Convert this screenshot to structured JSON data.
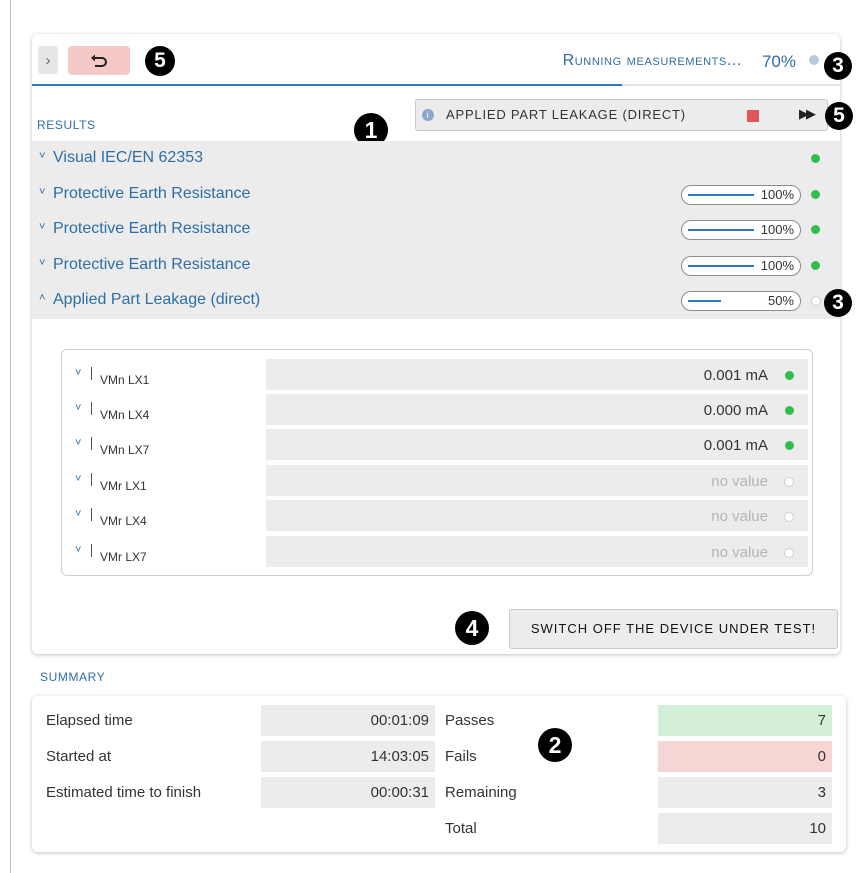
{
  "toolbar": {
    "collapse_glyph": "›",
    "back_icon": "undo-icon",
    "status_text": "Running measurements...",
    "progress_percent": "70%",
    "progress_fraction": 0.73
  },
  "callouts": {
    "one": "1",
    "two": "2",
    "three": "3",
    "four": "4",
    "five": "5"
  },
  "results": {
    "label": "RESULTS",
    "current_test": {
      "label": "APPLIED PART LEAKAGE (DIRECT)",
      "stop_icon": "stop-icon",
      "skip_glyph": "▶▶"
    },
    "tests": [
      {
        "name": "Visual IEC/EN 62353",
        "chevron": "˅",
        "progress": null,
        "progress_label": "",
        "status": "pass"
      },
      {
        "name": "Protective Earth Resistance",
        "chevron": "˅",
        "progress": 1.0,
        "progress_label": "100%",
        "status": "pass"
      },
      {
        "name": "Protective Earth Resistance",
        "chevron": "˅",
        "progress": 1.0,
        "progress_label": "100%",
        "status": "pass"
      },
      {
        "name": "Protective Earth Resistance",
        "chevron": "˅",
        "progress": 1.0,
        "progress_label": "100%",
        "status": "pass"
      },
      {
        "name": "Applied Part Leakage (direct)",
        "chevron": "˄",
        "progress": 0.5,
        "progress_label": "50%",
        "status": "pending"
      }
    ],
    "measurements": [
      {
        "name": "VMn LX1",
        "value": "0.001 mA",
        "status": "pass"
      },
      {
        "name": "VMn LX4",
        "value": "0.000 mA",
        "status": "pass"
      },
      {
        "name": "VMn LX7",
        "value": "0.001 mA",
        "status": "pass"
      },
      {
        "name": "VMr LX1",
        "value": "no value",
        "status": "pending"
      },
      {
        "name": "VMr LX4",
        "value": "no value",
        "status": "pending"
      },
      {
        "name": "VMr LX7",
        "value": "no value",
        "status": "pending"
      }
    ],
    "switch_button": "SWITCH OFF THE DEVICE UNDER TEST!"
  },
  "summary": {
    "label": "SUMMARY",
    "left": [
      {
        "label": "Elapsed time",
        "value": "00:01:09"
      },
      {
        "label": "Started at",
        "value": "14:03:05"
      },
      {
        "label": "Estimated time to finish",
        "value": "00:00:31"
      }
    ],
    "right": [
      {
        "label": "Passes",
        "value": "7",
        "kind": "pass"
      },
      {
        "label": "Fails",
        "value": "0",
        "kind": "fail"
      },
      {
        "label": "Remaining",
        "value": "3",
        "kind": "neutral"
      },
      {
        "label": "Total",
        "value": "10",
        "kind": "neutral"
      }
    ]
  },
  "colors": {
    "accent": "#2e6ea6",
    "progress_blue": "#2e79c0",
    "pass_green": "#2fbf4d",
    "pass_bg": "#d4efd7",
    "fail_bg": "#f6d5d5",
    "back_button_bg": "#f6c9c9",
    "stop_red": "#e05555"
  }
}
